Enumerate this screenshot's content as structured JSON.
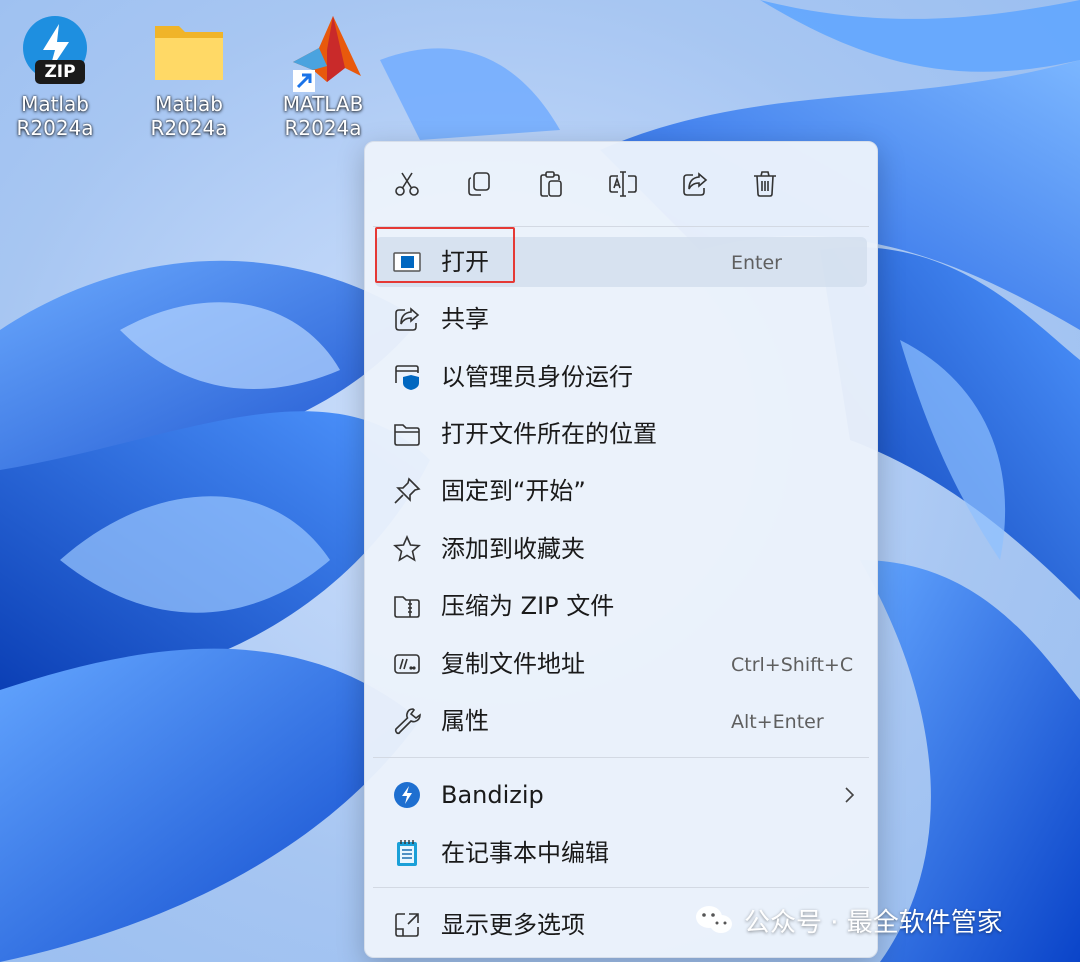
{
  "desktop": {
    "icons": [
      {
        "line1": "Matlab",
        "line2": "R2024a",
        "icon": "bandizip-zip-icon",
        "badge": "ZIP"
      },
      {
        "line1": "Matlab",
        "line2": "R2024a",
        "icon": "folder-icon"
      },
      {
        "line1": "MATLAB",
        "line2": "R2024a",
        "icon": "matlab-shortcut-icon"
      }
    ]
  },
  "menu": {
    "toolbar": [
      "cut-icon",
      "copy-icon",
      "paste-icon",
      "rename-icon",
      "share-icon",
      "delete-icon"
    ],
    "items": [
      {
        "label": "打开",
        "shortcut": "Enter",
        "icon": "open-app-icon",
        "highlighted": true
      },
      {
        "label": "共享",
        "shortcut": "",
        "icon": "share-icon"
      },
      {
        "label": "以管理员身份运行",
        "shortcut": "",
        "icon": "run-as-admin-shield-icon"
      },
      {
        "label": "打开文件所在的位置",
        "shortcut": "",
        "icon": "folder-open-icon"
      },
      {
        "label": "固定到“开始”",
        "shortcut": "",
        "icon": "pin-icon"
      },
      {
        "label": "添加到收藏夹",
        "shortcut": "",
        "icon": "star-icon"
      },
      {
        "label": "压缩为 ZIP 文件",
        "shortcut": "",
        "icon": "zip-folder-icon"
      },
      {
        "label": "复制文件地址",
        "shortcut": "Ctrl+Shift+C",
        "icon": "copy-path-icon"
      },
      {
        "label": "属性",
        "shortcut": "Alt+Enter",
        "icon": "wrench-icon"
      }
    ],
    "extra": [
      {
        "label": "Bandizip",
        "icon": "bandizip-icon",
        "submenu": true
      },
      {
        "label": "在记事本中编辑",
        "icon": "notepad-icon"
      }
    ],
    "more": {
      "label": "显示更多选项",
      "icon": "more-options-icon"
    }
  },
  "watermark": {
    "text": "公众号 · 最全软件管家",
    "icon": "wechat-icon"
  },
  "colors": {
    "accent": "#0067c0",
    "highlight_box": "#e53935",
    "wallpaper_blue": "#1f6ff0"
  }
}
